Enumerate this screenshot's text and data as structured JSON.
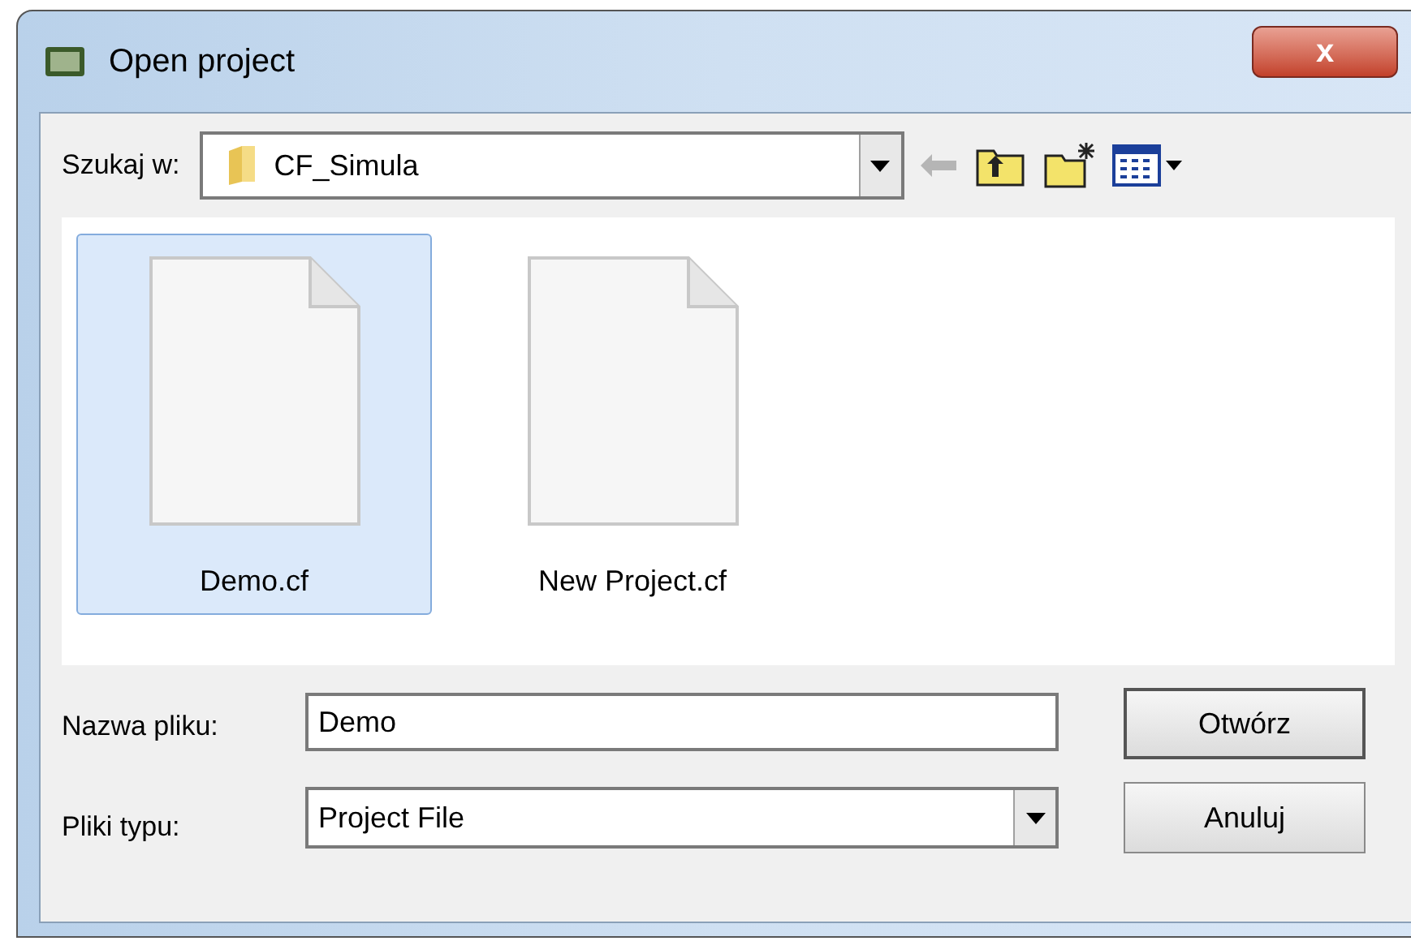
{
  "window": {
    "title": "Open project",
    "close": "x"
  },
  "look_in": {
    "label": "Szukaj w:",
    "value": "CF_Simula"
  },
  "files": [
    {
      "name": "Demo.cf",
      "selected": true
    },
    {
      "name": "New Project.cf",
      "selected": false
    }
  ],
  "file_name": {
    "label": "Nazwa pliku:",
    "value": "Demo"
  },
  "file_type": {
    "label": "Pliki typu:",
    "value": "Project File"
  },
  "buttons": [
    "Otwórz",
    "Anuluj"
  ]
}
